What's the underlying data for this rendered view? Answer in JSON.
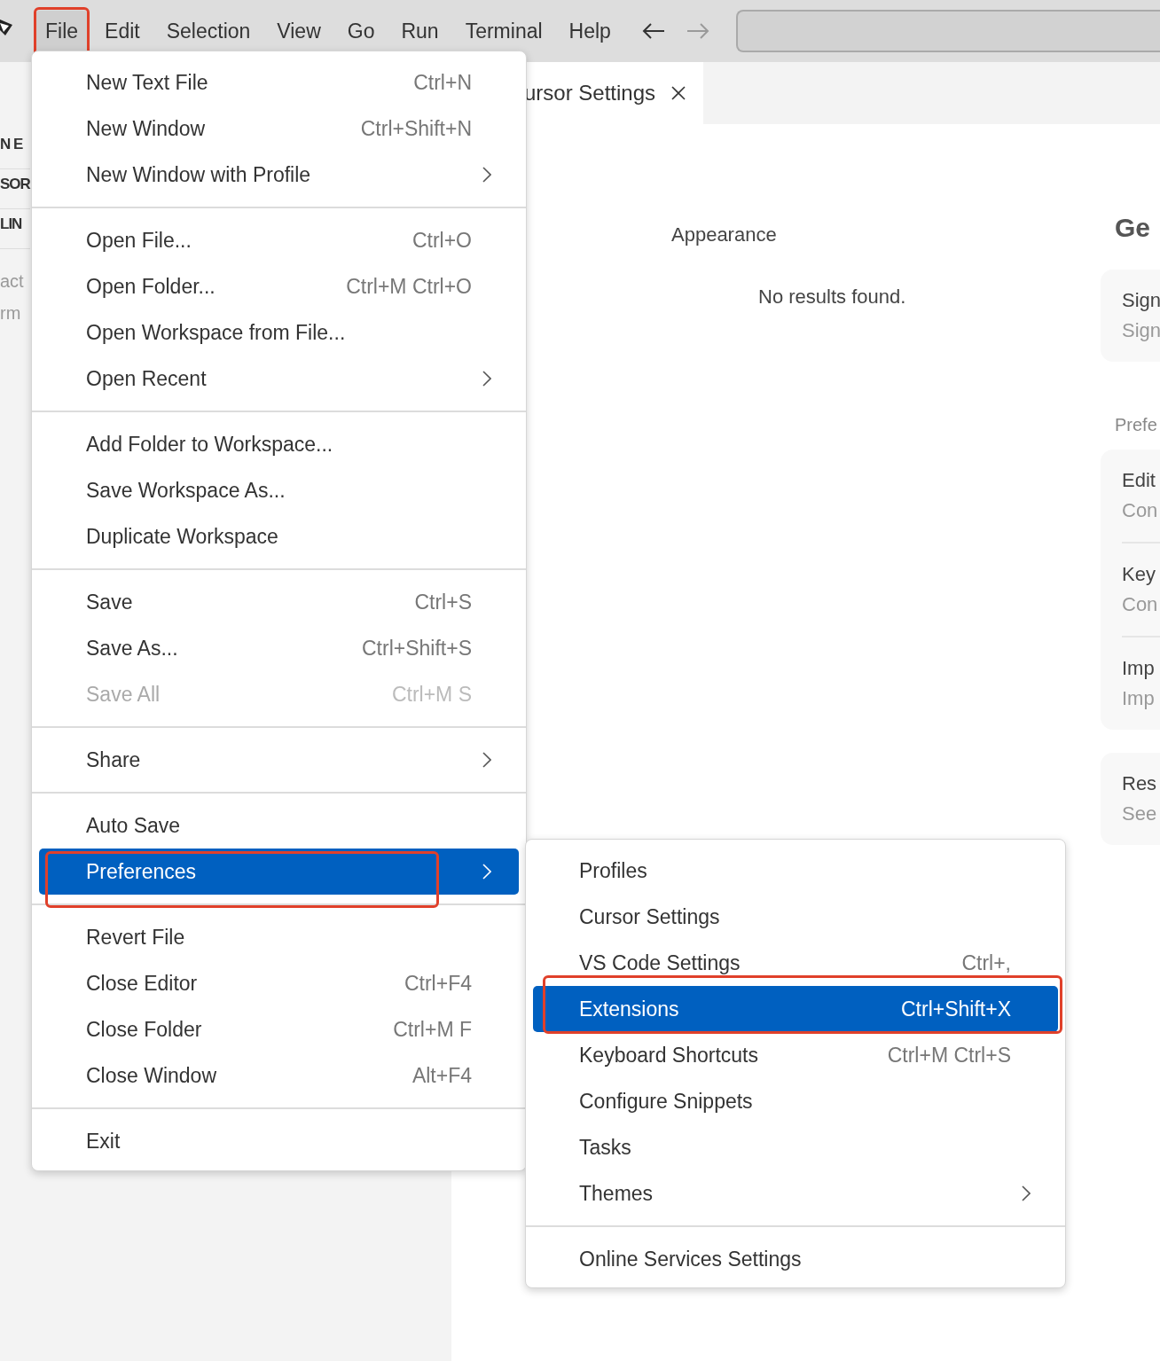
{
  "menubar": {
    "items": [
      {
        "label": "File",
        "selected": true,
        "annotated": true
      },
      {
        "label": "Edit",
        "selected": false,
        "annotated": false
      },
      {
        "label": "Selection",
        "selected": false,
        "annotated": false
      },
      {
        "label": "View",
        "selected": false,
        "annotated": false
      },
      {
        "label": "Go",
        "selected": false,
        "annotated": false
      },
      {
        "label": "Run",
        "selected": false,
        "annotated": false
      },
      {
        "label": "Terminal",
        "selected": false,
        "annotated": false
      },
      {
        "label": "Help",
        "selected": false,
        "annotated": false
      }
    ],
    "back": {
      "disabled": false
    },
    "forward": {
      "disabled": true
    }
  },
  "sidebar": {
    "headings": [
      "N E",
      "SOR",
      "LIN"
    ],
    "lines": [
      "act",
      "rm"
    ]
  },
  "tabs": [
    {
      "label": "ursor Settings",
      "selected": true
    }
  ],
  "settings": {
    "toc_item": "Appearance",
    "message": "No results found.",
    "heading": "Ge",
    "section_label": "Prefe",
    "cards": [
      [
        {
          "title": "Sign",
          "description": "Sign"
        }
      ],
      [
        {
          "title": "Edit",
          "description": "Con"
        },
        {
          "title": "Key",
          "description": "Con"
        },
        {
          "title": "Imp",
          "description": "Imp"
        }
      ],
      [
        {
          "title": "Res",
          "description": "See"
        }
      ]
    ]
  },
  "file_menu": {
    "groups": [
      [
        {
          "label": "New Text File",
          "shortcut": "Ctrl+N",
          "has_submenu": false,
          "disabled": false,
          "selected": false,
          "annotated": false
        },
        {
          "label": "New Window",
          "shortcut": "Ctrl+Shift+N",
          "has_submenu": false,
          "disabled": false,
          "selected": false,
          "annotated": false
        },
        {
          "label": "New Window with Profile",
          "has_submenu": true,
          "disabled": false,
          "selected": false,
          "annotated": false
        }
      ],
      [
        {
          "label": "Open File...",
          "shortcut": "Ctrl+O",
          "has_submenu": false,
          "disabled": false,
          "selected": false,
          "annotated": false
        },
        {
          "label": "Open Folder...",
          "shortcut": "Ctrl+M Ctrl+O",
          "has_submenu": false,
          "disabled": false,
          "selected": false,
          "annotated": false
        },
        {
          "label": "Open Workspace from File...",
          "has_submenu": false,
          "disabled": false,
          "selected": false,
          "annotated": false
        },
        {
          "label": "Open Recent",
          "has_submenu": true,
          "disabled": false,
          "selected": false,
          "annotated": false
        }
      ],
      [
        {
          "label": "Add Folder to Workspace...",
          "has_submenu": false,
          "disabled": false,
          "selected": false,
          "annotated": false
        },
        {
          "label": "Save Workspace As...",
          "has_submenu": false,
          "disabled": false,
          "selected": false,
          "annotated": false
        },
        {
          "label": "Duplicate Workspace",
          "has_submenu": false,
          "disabled": false,
          "selected": false,
          "annotated": false
        }
      ],
      [
        {
          "label": "Save",
          "shortcut": "Ctrl+S",
          "has_submenu": false,
          "disabled": false,
          "selected": false,
          "annotated": false
        },
        {
          "label": "Save As...",
          "shortcut": "Ctrl+Shift+S",
          "has_submenu": false,
          "disabled": false,
          "selected": false,
          "annotated": false
        },
        {
          "label": "Save All",
          "shortcut": "Ctrl+M S",
          "has_submenu": false,
          "disabled": true,
          "selected": false,
          "annotated": false
        }
      ],
      [
        {
          "label": "Share",
          "has_submenu": true,
          "disabled": false,
          "selected": false,
          "annotated": false
        }
      ],
      [
        {
          "label": "Auto Save",
          "has_submenu": false,
          "disabled": false,
          "selected": false,
          "annotated": false
        },
        {
          "label": "Preferences",
          "has_submenu": true,
          "disabled": false,
          "selected": true,
          "annotated": true
        }
      ],
      [
        {
          "label": "Revert File",
          "has_submenu": false,
          "disabled": false,
          "selected": false,
          "annotated": false
        },
        {
          "label": "Close Editor",
          "shortcut": "Ctrl+F4",
          "has_submenu": false,
          "disabled": false,
          "selected": false,
          "annotated": false
        },
        {
          "label": "Close Folder",
          "shortcut": "Ctrl+M F",
          "has_submenu": false,
          "disabled": false,
          "selected": false,
          "annotated": false
        },
        {
          "label": "Close Window",
          "shortcut": "Alt+F4",
          "has_submenu": false,
          "disabled": false,
          "selected": false,
          "annotated": false
        }
      ],
      [
        {
          "label": "Exit",
          "has_submenu": false,
          "disabled": false,
          "selected": false,
          "annotated": false
        }
      ]
    ]
  },
  "preferences_menu": {
    "groups": [
      [
        {
          "label": "Profiles",
          "has_submenu": false,
          "disabled": false,
          "selected": false,
          "annotated": false
        },
        {
          "label": "Cursor Settings",
          "has_submenu": false,
          "disabled": false,
          "selected": false,
          "annotated": false
        },
        {
          "label": "VS Code Settings",
          "shortcut": "Ctrl+,",
          "has_submenu": false,
          "disabled": false,
          "selected": false,
          "annotated": false
        },
        {
          "label": "Extensions",
          "shortcut": "Ctrl+Shift+X",
          "has_submenu": false,
          "disabled": false,
          "selected": true,
          "annotated": true
        },
        {
          "label": "Keyboard Shortcuts",
          "shortcut": "Ctrl+M Ctrl+S",
          "has_submenu": false,
          "disabled": false,
          "selected": false,
          "annotated": false
        },
        {
          "label": "Configure Snippets",
          "has_submenu": false,
          "disabled": false,
          "selected": false,
          "annotated": false
        },
        {
          "label": "Tasks",
          "has_submenu": false,
          "disabled": false,
          "selected": false,
          "annotated": false
        },
        {
          "label": "Themes",
          "has_submenu": true,
          "disabled": false,
          "selected": false,
          "annotated": false
        }
      ],
      [
        {
          "label": "Online Services Settings",
          "has_submenu": false,
          "disabled": false,
          "selected": false,
          "annotated": false
        }
      ]
    ]
  }
}
